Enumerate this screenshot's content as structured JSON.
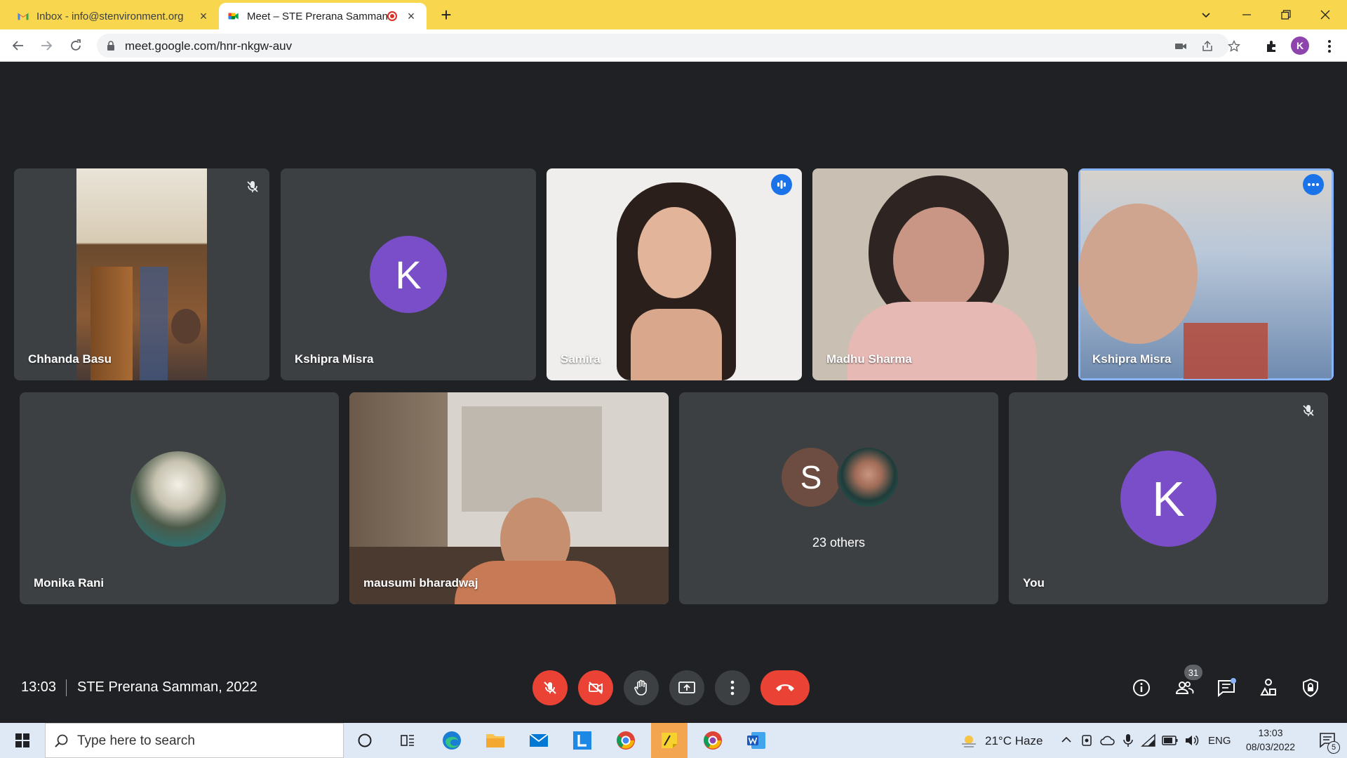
{
  "browser": {
    "tabs": [
      {
        "title": "Inbox - info@stenvironment.org",
        "active": false
      },
      {
        "title": "Meet – STE Prerana Samman",
        "active": true
      }
    ],
    "close_glyph": "×",
    "new_tab_glyph": "+",
    "url": "meet.google.com/hnr-nkgw-auv",
    "profile_initial": "K"
  },
  "tiles_row1": [
    {
      "name": "Chhanda Basu",
      "mic_muted": true
    },
    {
      "name": "Kshipra Misra",
      "avatar_initial": "K",
      "avatar_color": "#7b4ec9"
    },
    {
      "name": "Samira",
      "speaking": true
    },
    {
      "name": "Madhu Sharma"
    },
    {
      "name": "Kshipra Misra",
      "pinned_highlight": true
    }
  ],
  "tiles_row2": [
    {
      "name": "Monika Rani"
    },
    {
      "name": "mausumi bharadwaj"
    },
    {
      "name": "23 others",
      "stack_initial": "S",
      "stack_color": "#6d4c41"
    },
    {
      "name": "You",
      "avatar_initial": "K",
      "avatar_color": "#7b4ec9",
      "mic_muted": true
    }
  ],
  "meeting": {
    "time": "13:03",
    "title": "STE Prerana Samman, 2022",
    "participant_count": "31"
  },
  "taskbar": {
    "search_placeholder": "Type here to search",
    "weather": "21°C  Haze",
    "lang": "ENG",
    "time": "13:03",
    "date": "08/03/2022",
    "notifications": "5"
  },
  "colors": {
    "accent": "#1a73e8",
    "danger": "#ea4335",
    "tile": "#3c4043",
    "meet_bg": "#202124"
  }
}
